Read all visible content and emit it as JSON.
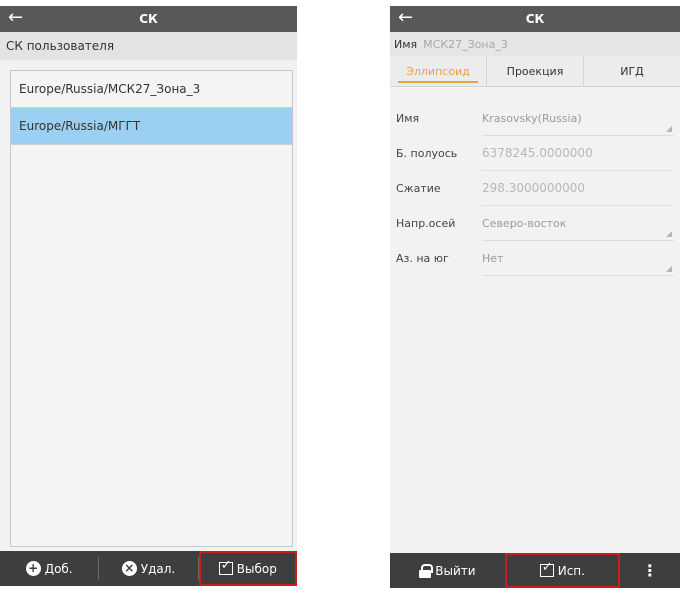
{
  "left": {
    "title": "СК",
    "subheader": "СК пользователя",
    "items": [
      {
        "label": "Europe/Russia/МСК27_Зона_3"
      },
      {
        "label": "Europe/Russia/МГГТ"
      }
    ],
    "bottom": {
      "add_label": "Доб.",
      "delete_label": "Удал.",
      "select_label": "Выбор"
    }
  },
  "right": {
    "title": "СК",
    "name_label": "Имя",
    "name_value": "МСК27_Зона_3",
    "tabs": [
      {
        "label": "Эллипсоид"
      },
      {
        "label": "Проекция"
      },
      {
        "label": "ИГД"
      }
    ],
    "fields": [
      {
        "label": "Имя",
        "value": "Krasovsky(Russia)"
      },
      {
        "label": "Б. полуось",
        "value": "6378245.0000000"
      },
      {
        "label": "Сжатие",
        "value": "298.3000000000"
      },
      {
        "label": "Напр.осей",
        "value": "Северо-восток"
      },
      {
        "label": "Аз. на юг",
        "value": "Нет"
      }
    ],
    "bottom": {
      "exit_label": "Выйти",
      "use_label": "Исп."
    }
  },
  "colors": {
    "appbar": "#585858",
    "selected_row": "#9cd0f3",
    "bottombar": "#3e3e3e",
    "active_tab": "#e8a050",
    "highlight_outline": "#c81e1e"
  },
  "icons": {
    "back": "back-arrow-icon",
    "add": "plus-circle-icon",
    "delete": "close-circle-icon",
    "select": "checkbox-icon",
    "exit": "lock-icon",
    "use": "checkbox-icon",
    "more": "more-vertical-icon"
  }
}
